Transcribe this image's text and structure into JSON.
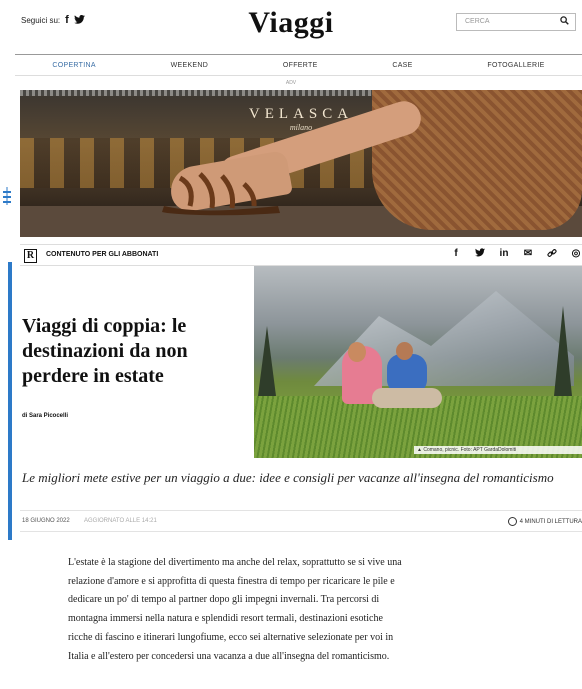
{
  "header": {
    "follow_label": "Seguici su:",
    "social": [
      {
        "icon": "facebook-icon",
        "glyph": "f"
      },
      {
        "icon": "twitter-icon",
        "glyph": "🐦"
      }
    ],
    "logo": "Viaggi",
    "search_placeholder": "CERCA"
  },
  "nav": {
    "items": [
      {
        "label": "COPERTINA",
        "active": true
      },
      {
        "label": "WEEKEND",
        "active": false
      },
      {
        "label": "OFFERTE",
        "active": false
      },
      {
        "label": "CASE",
        "active": false
      },
      {
        "label": "FOTOGALLERIE",
        "active": false
      }
    ]
  },
  "ad": {
    "label": "ADV",
    "brand": "VELASCA",
    "brand_sub": "milano"
  },
  "subscriber_bar": {
    "badge": "R",
    "label": "CONTENUTO PER GLI ABBONATI",
    "share_icons": [
      {
        "name": "facebook-share-icon",
        "glyph": "f"
      },
      {
        "name": "twitter-share-icon",
        "glyph": "𝕥"
      },
      {
        "name": "linkedin-share-icon",
        "glyph": "in"
      },
      {
        "name": "email-share-icon",
        "glyph": "✉"
      },
      {
        "name": "link-share-icon",
        "glyph": "🔗"
      },
      {
        "name": "whatsapp-share-icon",
        "glyph": "◎"
      }
    ]
  },
  "article": {
    "title": "Viaggi di coppia: le destinazioni da non perdere in estate",
    "author": "di Sara Picocelli",
    "photo_caption": "▲ Comano, picnic. Foto: APT GardaDolomiti",
    "subtitle": "Le migliori mete estive per un viaggio a due: idee e consigli per vacanze all'insegna del romanticismo",
    "date": "18 GIUGNO 2022",
    "updated": "AGGIORNATO ALLE 14:21",
    "read_time": "4 MINUTI DI LETTURA",
    "body": "L'estate è la stagione del divertimento ma anche del relax, soprattutto se si vive una relazione d'amore e si approfitta di questa finestra di tempo per ricaricare le pile e dedicare un po' di tempo al partner dopo gli impegni invernali. Tra percorsi di montagna immersi nella natura e splendidi resort termali, destinazioni esotiche ricche di fascino e itinerari lungofiume, ecco sei alternative selezionate per voi in Italia e all'estero per concedersi una vacanza a due all'insegna del romanticismo."
  },
  "colors": {
    "accent_blue": "#2d7ac8",
    "nav_active": "#3a6ea5"
  }
}
